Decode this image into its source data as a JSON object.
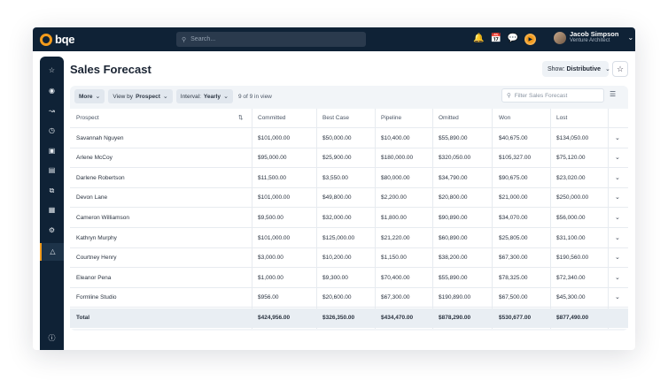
{
  "brand": {
    "name": "bqe",
    "accent": "#f39b1c",
    "nav_bg": "#0f2236"
  },
  "search": {
    "placeholder": "Search..."
  },
  "topbar_icons": [
    "bell-icon",
    "calendar-icon",
    "chat-icon",
    "timer-play-icon"
  ],
  "user": {
    "name": "Jacob Simpson",
    "role": "Venture Architect"
  },
  "sidebar": {
    "items": [
      "star-icon",
      "dashboard-icon",
      "chart-icon",
      "clock-icon",
      "briefcase-icon",
      "document-icon",
      "copy-icon",
      "invoice-icon",
      "people-icon",
      "sales-icon",
      "help-icon"
    ],
    "active_index": 9
  },
  "page": {
    "title": "Sales Forecast"
  },
  "show": {
    "label": "Show:",
    "value": "Distributive"
  },
  "toolbar": {
    "more": "More",
    "view_label": "View by",
    "view_value": "Prospect",
    "interval_label": "Interval:",
    "interval_value": "Yearly",
    "count": "9 of 9 in view"
  },
  "filter": {
    "placeholder": "Filter Sales Forecast"
  },
  "table": {
    "headers": [
      "Prospect",
      "Committed",
      "Best Case",
      "Pipeline",
      "Omitted",
      "Won",
      "Lost"
    ],
    "rows": [
      [
        "Savannah Nguyen",
        "$101,000.00",
        "$50,000.00",
        "$10,400.00",
        "$55,890.00",
        "$40,675.00",
        "$134,050.00"
      ],
      [
        "Arlene McCoy",
        "$95,000.00",
        "$25,900.00",
        "$180,000.00",
        "$320,050.00",
        "$105,327.00",
        "$75,120.00"
      ],
      [
        "Darlene Robertson",
        "$11,500.00",
        "$3,550.00",
        "$80,000.00",
        "$34,790.00",
        "$90,675.00",
        "$23,020.00"
      ],
      [
        "Devon Lane",
        "$101,000.00",
        "$49,800.00",
        "$2,200.00",
        "$20,800.00",
        "$21,000.00",
        "$250,000.00"
      ],
      [
        "Cameron Williamson",
        "$9,500.00",
        "$32,000.00",
        "$1,800.00",
        "$90,890.00",
        "$34,070.00",
        "$56,000.00"
      ],
      [
        "Kathryn Murphy",
        "$101,000.00",
        "$125,000.00",
        "$21,220.00",
        "$60,890.00",
        "$25,805.00",
        "$31,100.00"
      ],
      [
        "Courtney Henry",
        "$3,000.00",
        "$10,200.00",
        "$1,150.00",
        "$38,200.00",
        "$67,300.00",
        "$190,560.00"
      ],
      [
        "Eleanor Pena",
        "$1,000.00",
        "$9,300.00",
        "$70,400.00",
        "$55,890.00",
        "$78,325.00",
        "$72,340.00"
      ],
      [
        "Formline Studio",
        "$956.00",
        "$20,600.00",
        "$67,300.00",
        "$190,890.00",
        "$67,500.00",
        "$45,300.00"
      ]
    ],
    "total": [
      "Total",
      "$424,956.00",
      "$326,350.00",
      "$434,470.00",
      "$878,290.00",
      "$530,677.00",
      "$877,490.00"
    ]
  }
}
